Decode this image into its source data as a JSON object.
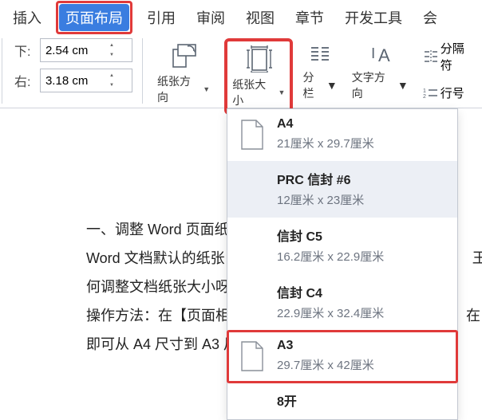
{
  "tabs": {
    "insert": "插入",
    "page_layout": "页面布局",
    "references": "引用",
    "review": "审阅",
    "view": "视图",
    "section": "章节",
    "developer": "开发工具",
    "meeting_first": "会"
  },
  "margins": {
    "bottom_label": "下:",
    "bottom_value": "2.54 cm",
    "right_label": "右:",
    "right_value": "3.18 cm"
  },
  "toolbar": {
    "orientation_label": "纸张方向",
    "paper_size_label": "纸张大小",
    "columns_label": "分栏",
    "text_direction_label": "文字方向",
    "breaks_label": "分隔符",
    "line_numbers_label": "行号"
  },
  "dropdown": {
    "items": [
      {
        "title": "A4",
        "dim": "21厘米  x  29.7厘米",
        "show_icon": true,
        "selected": false,
        "highlight": false
      },
      {
        "title": "PRC 信封 #6",
        "dim": "12厘米  x  23厘米",
        "show_icon": false,
        "selected": true,
        "highlight": false
      },
      {
        "title": "信封 C5",
        "dim": "16.2厘米  x  22.9厘米",
        "show_icon": false,
        "selected": false,
        "highlight": false
      },
      {
        "title": "信封 C4",
        "dim": "22.9厘米  x  32.4厘米",
        "show_icon": false,
        "selected": false,
        "highlight": false
      },
      {
        "title": "A3",
        "dim": "29.7厘米  x  42厘米",
        "show_icon": true,
        "selected": false,
        "highlight": true
      },
      {
        "title": "8开",
        "dim": "",
        "show_icon": false,
        "selected": false,
        "highlight": false
      }
    ]
  },
  "content": {
    "line1": "一、调整 Word 页面纸",
    "line2": "Word 文档默认的纸张",
    "line2_tail": "王",
    "line3": "何调整文档纸张大小呀",
    "line4": "操作方法：在【页面相",
    "line4_tail": "在",
    "line5": "即可从 A4 尺寸到 A3 尺"
  }
}
